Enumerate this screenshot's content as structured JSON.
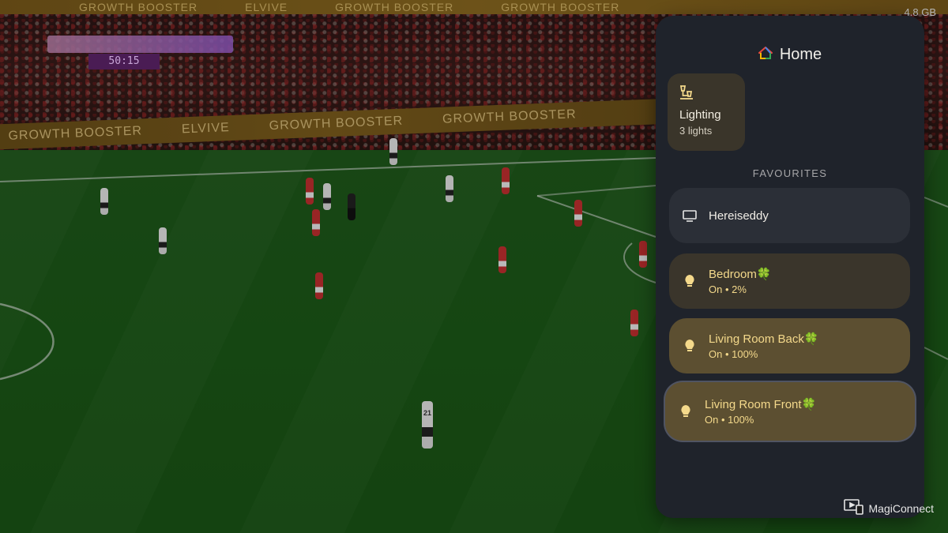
{
  "video": {
    "banner_texts": [
      "GROWTH BOOSTER",
      "ELVIVE",
      "GROWTH BOOSTER",
      "GROWTH BOOSTER"
    ],
    "side_banner_texts": [
      "GROWTH BOOSTER",
      "ELVIVE",
      "GROWTH BOOSTER",
      "GROWTH BOOSTER"
    ],
    "player_number": "21",
    "score_clock": "50:15"
  },
  "system": {
    "storage": "4.8 GB"
  },
  "panel": {
    "title": "Home",
    "lighting_tile": {
      "label": "Lighting",
      "count": "3 lights"
    },
    "section_label": "FAVOURITES",
    "favourites": [
      {
        "name": "Hereiseddy",
        "type": "device",
        "icon": "tv-icon"
      },
      {
        "name": "Bedroom",
        "status": "On • 2%",
        "type": "light",
        "icon": "lightbulb-icon"
      },
      {
        "name": "Living Room Back",
        "status": "On • 100%",
        "type": "light",
        "icon": "lightbulb-icon"
      },
      {
        "name": "Living Room Front",
        "status": "On • 100%",
        "type": "light",
        "icon": "lightbulb-icon"
      }
    ]
  },
  "watermark": {
    "label": "MagiConnect"
  },
  "colors": {
    "panel_bg": "#1f232b",
    "accent_light": "#f4d98b",
    "tile_bg": "#3a352a"
  }
}
